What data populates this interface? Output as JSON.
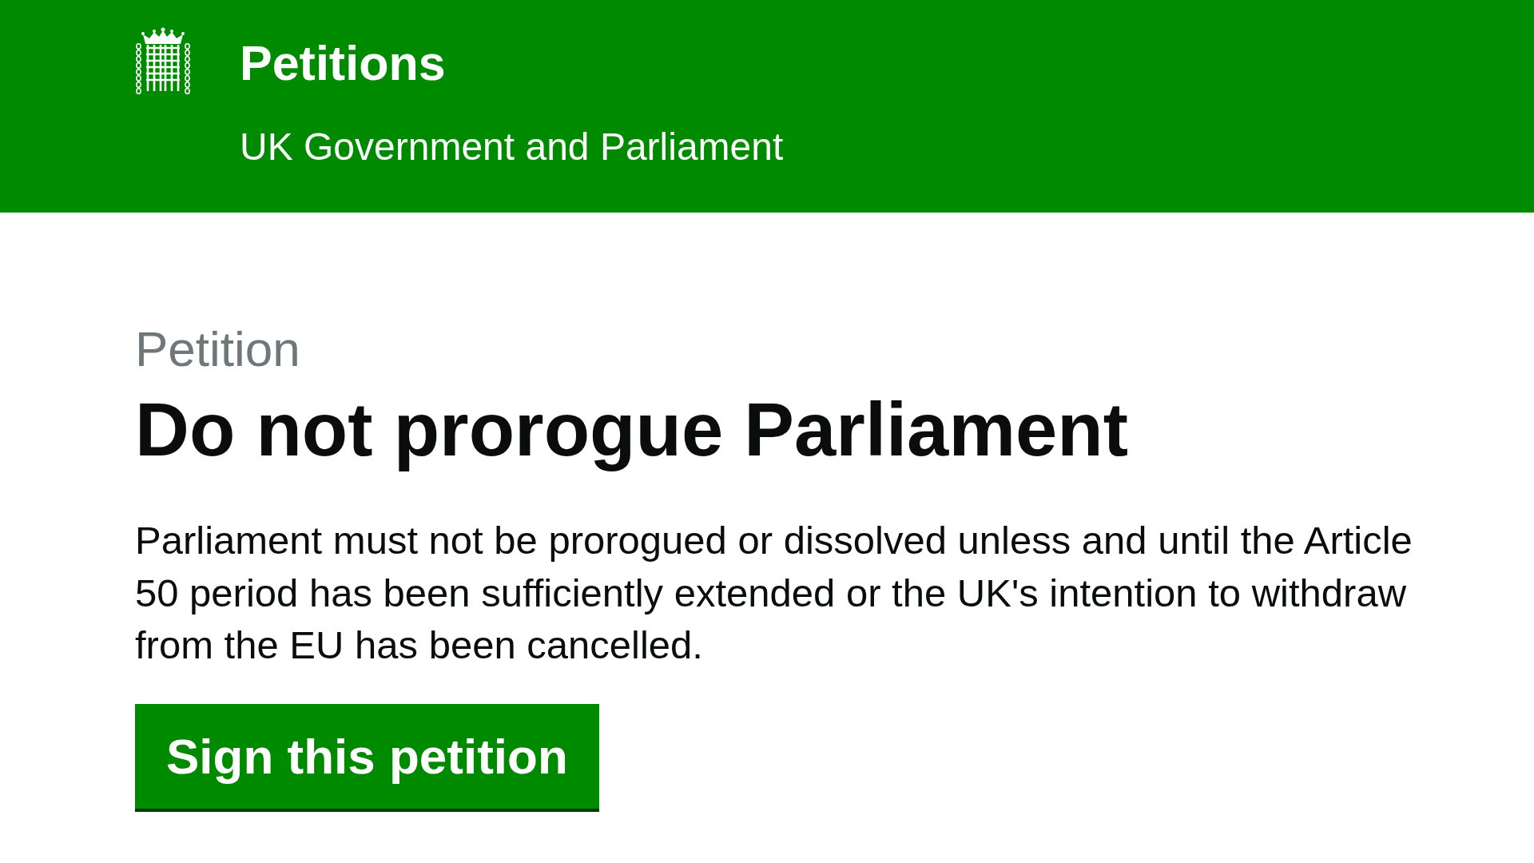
{
  "header": {
    "title": "Petitions",
    "subtitle": "UK Government and Parliament"
  },
  "petition": {
    "label": "Petition",
    "title": "Do not prorogue Parliament",
    "description": "Parliament must not be prorogued or dissolved unless and until the Article 50 period has been sufficiently extended or the UK's intention to withdraw from the EU has been cancelled.",
    "action": "Sign this petition"
  }
}
